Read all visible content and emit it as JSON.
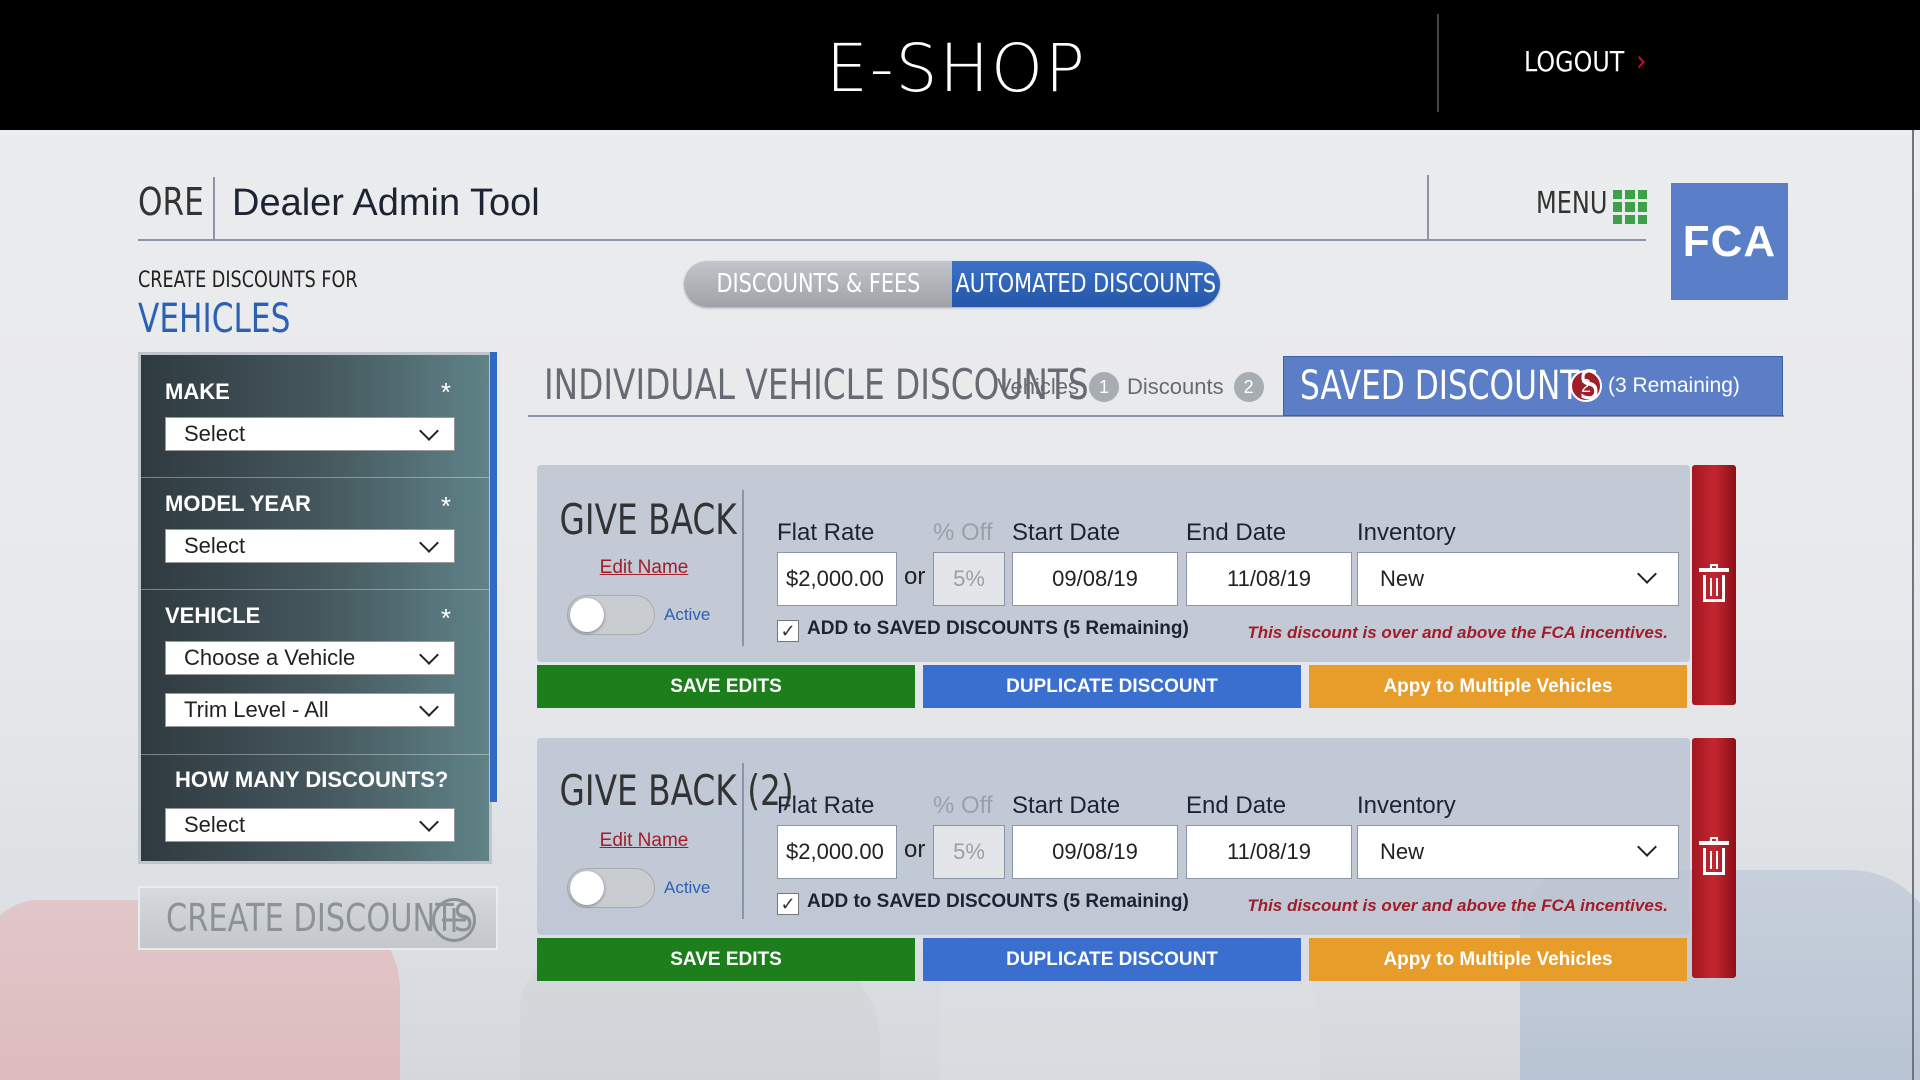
{
  "header": {
    "logo": "E-SHOP",
    "logout": "LOGOUT"
  },
  "title_bar": {
    "ore": "ORE",
    "title": "Dealer Admin Tool",
    "menu": "MENU",
    "brand": "FCA"
  },
  "intro": {
    "create_for": "CREATE DISCOUNTS FOR",
    "target": "VEHICLES"
  },
  "tabs": [
    {
      "label": "DISCOUNTS & FEES",
      "active": false
    },
    {
      "label": "AUTOMATED DISCOUNTS",
      "active": true
    }
  ],
  "sidebar": {
    "make": {
      "label": "MAKE",
      "required": "*",
      "value": "Select"
    },
    "model_year": {
      "label": "MODEL YEAR",
      "required": "*",
      "value": "Select"
    },
    "vehicle": {
      "label": "VEHICLE",
      "required": "*",
      "value": "Choose a Vehicle",
      "trim": "Trim Level - All"
    },
    "how_many": {
      "label": "HOW MANY DISCOUNTS?",
      "value": "Select"
    },
    "create_button": "CREATE DISCOUNTS"
  },
  "section": {
    "title": "INDIVIDUAL VEHICLE DISCOUNTS",
    "vehicles_label": "Vehicles",
    "vehicles_count": "1",
    "discounts_label": "Discounts",
    "discounts_count": "2",
    "saved_title": "SAVED DISCOUNTS",
    "saved_count": "2",
    "saved_remaining": "(3 Remaining)"
  },
  "fields": {
    "flat_rate": "Flat Rate",
    "percent_off": "% Off",
    "start_date": "Start Date",
    "end_date": "End Date",
    "inventory": "Inventory",
    "or": "or"
  },
  "discounts": [
    {
      "name": "GIVE BACK",
      "edit_name": "Edit Name",
      "active_label": "Active",
      "flat_rate": "$2,000.00",
      "percent": "5%",
      "start_date": "09/08/19",
      "end_date": "11/08/19",
      "inventory": "New",
      "add_saved": "ADD to SAVED DISCOUNTS (5 Remaining)",
      "note": "This discount is over and above the FCA incentives.",
      "save": "SAVE EDITS",
      "duplicate": "DUPLICATE DISCOUNT",
      "apply_multi": "Appy to Multiple Vehicles"
    },
    {
      "name": "GIVE BACK (2)",
      "edit_name": "Edit Name",
      "active_label": "Active",
      "flat_rate": "$2,000.00",
      "percent": "5%",
      "start_date": "09/08/19",
      "end_date": "11/08/19",
      "inventory": "New",
      "add_saved": "ADD to SAVED DISCOUNTS (5 Remaining)",
      "note": "This discount is over and above the FCA incentives.",
      "save": "SAVE EDITS",
      "duplicate": "DUPLICATE DISCOUNT",
      "apply_multi": "Appy to Multiple Vehicles"
    }
  ],
  "colors": {
    "accent_blue": "#2b61b5",
    "save_green": "#1d7f1b",
    "duplicate_blue": "#3a6fd0",
    "multi_orange": "#e89d2b",
    "danger_red": "#a01d2a",
    "menu_green": "#3da14a",
    "fca_blue": "#5a7ec8"
  }
}
